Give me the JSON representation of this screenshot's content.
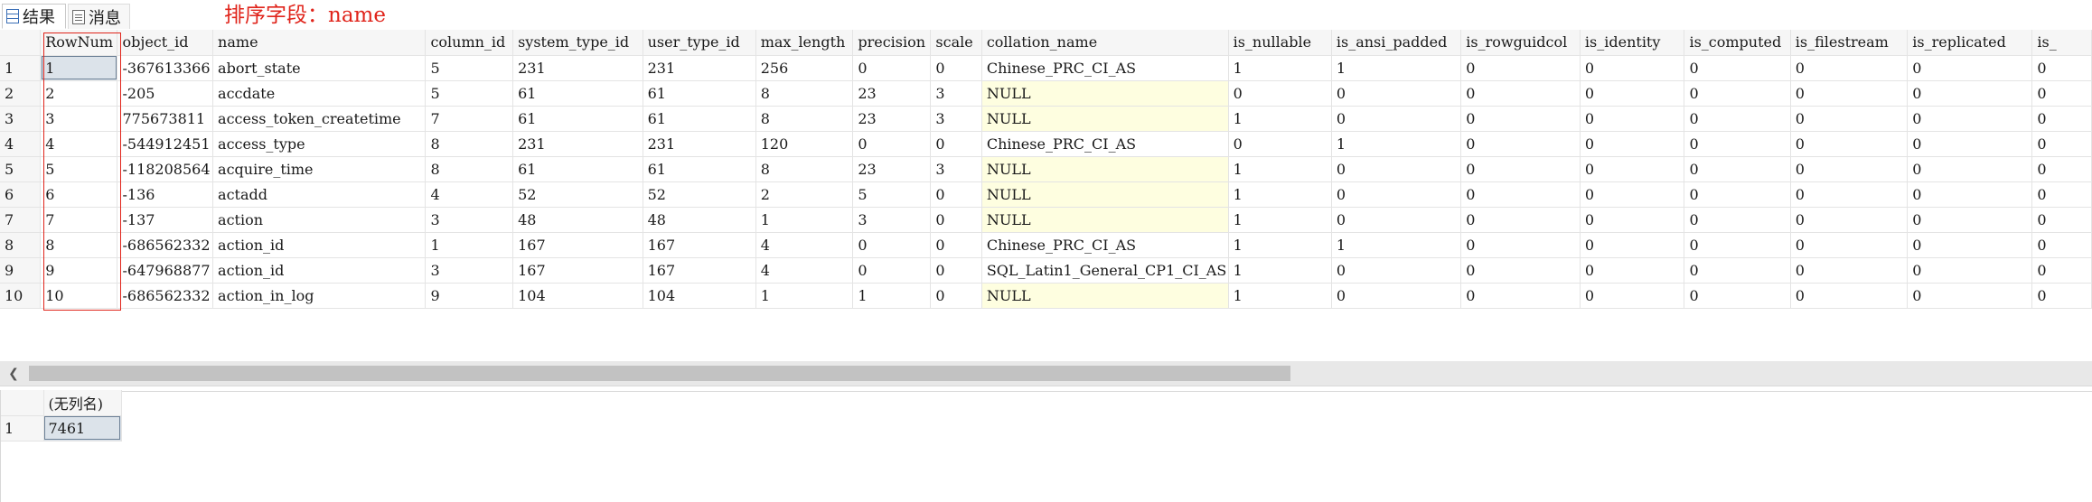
{
  "tabs": {
    "results": {
      "label": "结果",
      "icon": "grid-icon"
    },
    "messages": {
      "label": "消息",
      "icon": "message-icon"
    }
  },
  "annotation": "排序字段：name",
  "grid": {
    "columns": [
      "RowNum",
      "object_id",
      "name",
      "column_id",
      "system_type_id",
      "user_type_id",
      "max_length",
      "precision",
      "scale",
      "collation_name",
      "is_nullable",
      "is_ansi_padded",
      "is_rowguidcol",
      "is_identity",
      "is_computed",
      "is_filestream",
      "is_replicated",
      "is_"
    ],
    "rows": [
      {
        "n": "1",
        "c": [
          "1",
          "-367613366",
          "abort_state",
          "5",
          "231",
          "231",
          "256",
          "0",
          "0",
          "Chinese_PRC_CI_AS",
          "1",
          "1",
          "0",
          "0",
          "0",
          "0",
          "0",
          "0"
        ]
      },
      {
        "n": "2",
        "c": [
          "2",
          "-205",
          "accdate",
          "5",
          "61",
          "61",
          "8",
          "23",
          "3",
          "NULL",
          "0",
          "0",
          "0",
          "0",
          "0",
          "0",
          "0",
          "0"
        ]
      },
      {
        "n": "3",
        "c": [
          "3",
          "775673811",
          "access_token_createtime",
          "7",
          "61",
          "61",
          "8",
          "23",
          "3",
          "NULL",
          "1",
          "0",
          "0",
          "0",
          "0",
          "0",
          "0",
          "0"
        ]
      },
      {
        "n": "4",
        "c": [
          "4",
          "-544912451",
          "access_type",
          "8",
          "231",
          "231",
          "120",
          "0",
          "0",
          "Chinese_PRC_CI_AS",
          "0",
          "1",
          "0",
          "0",
          "0",
          "0",
          "0",
          "0"
        ]
      },
      {
        "n": "5",
        "c": [
          "5",
          "-118208564",
          "acquire_time",
          "8",
          "61",
          "61",
          "8",
          "23",
          "3",
          "NULL",
          "1",
          "0",
          "0",
          "0",
          "0",
          "0",
          "0",
          "0"
        ]
      },
      {
        "n": "6",
        "c": [
          "6",
          "-136",
          "actadd",
          "4",
          "52",
          "52",
          "2",
          "5",
          "0",
          "NULL",
          "1",
          "0",
          "0",
          "0",
          "0",
          "0",
          "0",
          "0"
        ]
      },
      {
        "n": "7",
        "c": [
          "7",
          "-137",
          "action",
          "3",
          "48",
          "48",
          "1",
          "3",
          "0",
          "NULL",
          "1",
          "0",
          "0",
          "0",
          "0",
          "0",
          "0",
          "0"
        ]
      },
      {
        "n": "8",
        "c": [
          "8",
          "-686562332",
          "action_id",
          "1",
          "167",
          "167",
          "4",
          "0",
          "0",
          "Chinese_PRC_CI_AS",
          "1",
          "1",
          "0",
          "0",
          "0",
          "0",
          "0",
          "0"
        ]
      },
      {
        "n": "9",
        "c": [
          "9",
          "-647968877",
          "action_id",
          "3",
          "167",
          "167",
          "4",
          "0",
          "0",
          "SQL_Latin1_General_CP1_CI_AS",
          "1",
          "0",
          "0",
          "0",
          "0",
          "0",
          "0",
          "0"
        ]
      },
      {
        "n": "10",
        "c": [
          "10",
          "-686562332",
          "action_in_log",
          "9",
          "104",
          "104",
          "1",
          "1",
          "0",
          "NULL",
          "1",
          "0",
          "0",
          "0",
          "0",
          "0",
          "0",
          "0"
        ]
      }
    ]
  },
  "grid2": {
    "columns": [
      "(无列名)"
    ],
    "rows": [
      {
        "n": "1",
        "c": [
          "7461"
        ]
      }
    ]
  },
  "scrollbar": {
    "left_icon": "chevron-left-icon"
  },
  "colors": {
    "annotation": "#e0241b",
    "null_bg": "#fefee0",
    "selected_bg": "#dce3ea"
  }
}
